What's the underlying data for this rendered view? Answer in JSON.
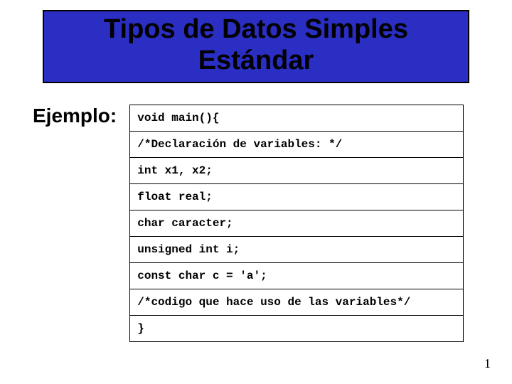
{
  "title": "Tipos de Datos Simples Estándar",
  "label": "Ejemplo:",
  "code_lines": [
    "void main(){",
    "/*Declaración de variables: */",
    "int x1, x2;",
    "float real;",
    "char caracter;",
    "unsigned int i;",
    "const char c = 'a';",
    "/*codigo que hace uso de las variables*/",
    "}"
  ],
  "page_number": "1"
}
